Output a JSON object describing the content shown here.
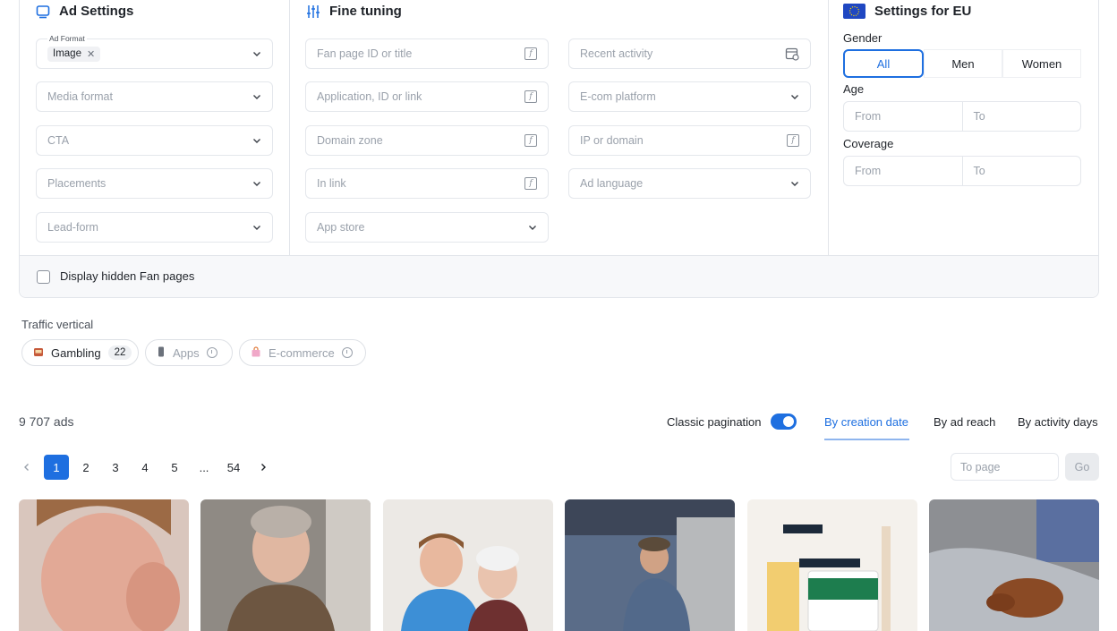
{
  "ad_settings": {
    "title": "Ad Settings",
    "ad_format_label": "Ad Format",
    "ad_format_value": "Image",
    "media_format": "Media format",
    "cta": "CTA",
    "placements": "Placements",
    "lead_form": "Lead-form"
  },
  "fine_tuning": {
    "title": "Fine tuning",
    "fan_page": "Fan page ID or title",
    "application": "Application, ID or link",
    "domain_zone": "Domain zone",
    "in_link": "In link",
    "app_store": "App store",
    "recent_activity": "Recent activity",
    "ecom_platform": "E-com platform",
    "ip_domain": "IP or domain",
    "ad_language": "Ad language"
  },
  "eu": {
    "title": "Settings for EU",
    "gender_label": "Gender",
    "gender_options": [
      "All",
      "Men",
      "Women"
    ],
    "gender_selected": "All",
    "age_label": "Age",
    "age_from": "From",
    "age_to": "To",
    "coverage_label": "Coverage",
    "coverage_from": "From",
    "coverage_to": "To"
  },
  "display_hidden_label": "Display hidden Fan pages",
  "traffic_vertical": {
    "label": "Traffic vertical",
    "items": [
      {
        "label": "Gambling",
        "count": "22",
        "icon": "slot-machine-icon"
      },
      {
        "label": "Apps",
        "icon": "phone-icon"
      },
      {
        "label": "E-commerce",
        "icon": "shopping-bag-icon"
      }
    ]
  },
  "results": {
    "count": "9 707 ads",
    "classic_pagination": "Classic pagination",
    "classic_pagination_on": true,
    "sort_options": [
      "By creation date",
      "By ad reach",
      "By activity days"
    ],
    "sort_active": "By creation date"
  },
  "pagination": {
    "pages": [
      "1",
      "2",
      "3",
      "4",
      "5",
      "...",
      "54"
    ],
    "current": "1",
    "to_page_placeholder": "To page",
    "go_label": "Go"
  },
  "colors": {
    "accent": "#1e6fe0",
    "border": "#e4e7ec",
    "muted_text": "#9aa1ab"
  }
}
